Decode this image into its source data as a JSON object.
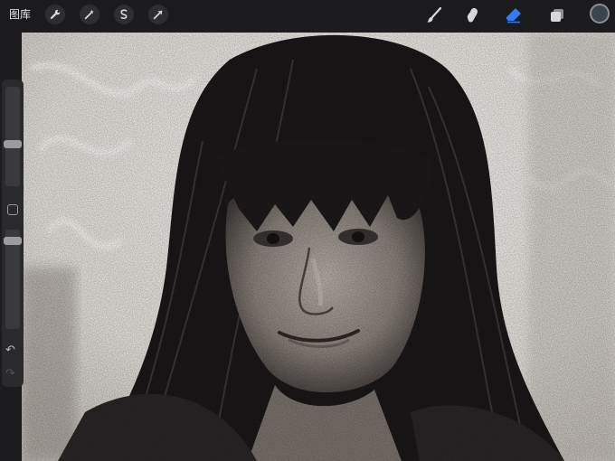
{
  "toolbar": {
    "gallery_label": "图库",
    "left_tools": [
      "wrench-icon",
      "magic-wand-icon",
      "selection-icon",
      "transform-arrow-icon"
    ],
    "right_tools": [
      "brush-icon",
      "smudge-icon",
      "eraser-icon",
      "layers-icon"
    ],
    "active_tool": "eraser",
    "accent": "#2f7cf6",
    "current_color": "#3a4450"
  },
  "sidebar": {
    "brush_size_level": 0.55,
    "opacity_level": 0.9,
    "modify_icon": "square-icon",
    "undo_label": "↶",
    "redo_label": "↷"
  },
  "canvas": {
    "subject": "",
    "palette": [
      "#f4f2ef",
      "#1a1718",
      "#8c8580",
      "#c9c2b9"
    ]
  }
}
